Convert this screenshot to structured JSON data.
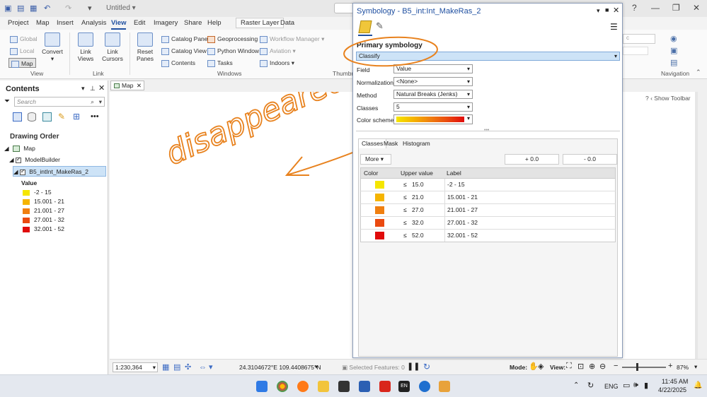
{
  "window": {
    "title": "Untitled",
    "minimize": "—",
    "restore": "❐",
    "close": "✕",
    "help": "?"
  },
  "ribbon_tabs": [
    "Project",
    "Map",
    "Insert",
    "Analysis",
    "View",
    "Edit",
    "Imagery",
    "Share",
    "Help"
  ],
  "context_tab_group": "Raster Layer",
  "context_tab": "Data",
  "ribbon": {
    "view_group": {
      "global": "Global",
      "local": "Local",
      "map": "Map",
      "convert": "Convert",
      "label": "View"
    },
    "link_group": {
      "link_views": "Link Views",
      "link_cursors": "Link Cursors",
      "label": "Link"
    },
    "windows_group": {
      "reset_panes": "Reset Panes",
      "catalog_pane": "Catalog Pane",
      "catalog_view": "Catalog View",
      "contents": "Contents",
      "geoprocessing": "Geoprocessing",
      "python_window": "Python Window",
      "tasks": "Tasks",
      "workflow_manager": "Workflow Manager",
      "aviation": "Aviation",
      "indoors": "Indoors",
      "label": "Windows"
    },
    "thumbnail_label": "Thumbna",
    "navigation_label": "Navigation",
    "search_partial": "c"
  },
  "contents_pane": {
    "title": "Contents",
    "search_placeholder": "Search",
    "drawing_order": "Drawing Order",
    "map_name": "Map",
    "group_name": "ModelBuilder",
    "layer_name": "B5_intInt_MakeRas_2",
    "value_heading": "Value",
    "legend": [
      {
        "label": "-2 - 15",
        "color": "#f5e600"
      },
      {
        "label": "15.001 - 21",
        "color": "#f5b400"
      },
      {
        "label": "21.001 - 27",
        "color": "#f07f10"
      },
      {
        "label": "27.001 - 32",
        "color": "#ea4a10"
      },
      {
        "label": "32.001 - 52",
        "color": "#e00b0b"
      }
    ]
  },
  "map_view": {
    "tab_label": "Map",
    "show_toolbar": "Show Toolbar",
    "annotation_text": "disappeared!"
  },
  "statusbar": {
    "scale": "1:230,364",
    "coordinates": "24.3104672°E 109.4408675°N",
    "selected_features": "Selected Features: 0",
    "mode_label": "Mode:",
    "view_label": "View:",
    "zoom_percent": "87%"
  },
  "symbology": {
    "title": "Symbology - B5_int:Int_MakeRas_2",
    "heading": "Primary symbology",
    "method_selector": "Classify",
    "field_label": "Field",
    "field_value": "Value",
    "normalization_label": "Normalization",
    "normalization_value": "<None>",
    "method_label": "Method",
    "method_value": "Natural Breaks (Jenks)",
    "classes_label": "Classes",
    "classes_value": "5",
    "color_scheme_label": "Color scheme",
    "tabs": [
      "Classes",
      "Mask",
      "Histogram"
    ],
    "more_button": "More",
    "plus_button": "+ 0.0",
    "minus_button": "- 0.0",
    "columns": [
      "Color",
      "Upper value",
      "Label"
    ],
    "le_symbol": "≤",
    "rows": [
      {
        "color": "#f5e600",
        "upper": "15.0",
        "label": "-2 - 15"
      },
      {
        "color": "#f5b400",
        "upper": "21.0",
        "label": "15.001 - 21"
      },
      {
        "color": "#f07f10",
        "upper": "27.0",
        "label": "21.001 - 27"
      },
      {
        "color": "#ea4a10",
        "upper": "32.0",
        "label": "27.001 - 32"
      },
      {
        "color": "#e00b0b",
        "upper": "52.0",
        "label": "32.001 - 52"
      }
    ]
  },
  "taskbar": {
    "language": "ENG",
    "time": "11:45 AM",
    "date": "4/22/2025",
    "en_badge": "EN"
  },
  "colors": {
    "accent": "#1f4fa0",
    "annotation": "#e8821e",
    "selection": "#cde3f7"
  }
}
